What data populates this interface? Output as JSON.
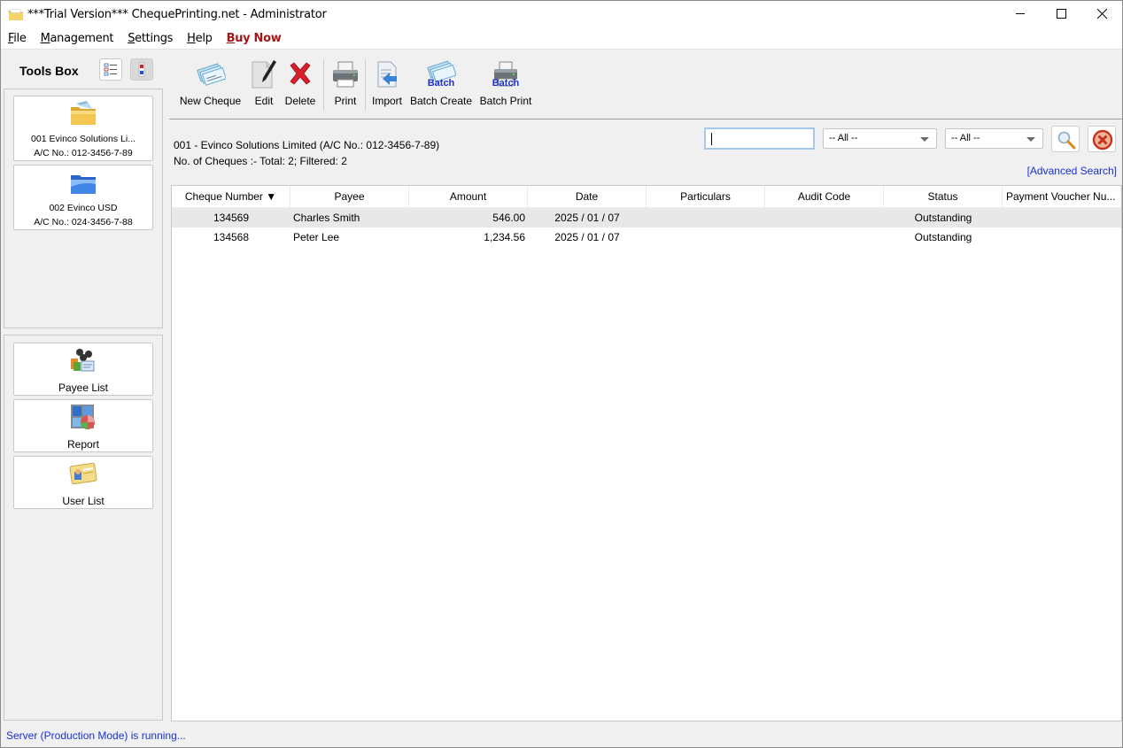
{
  "window": {
    "title": "***Trial Version*** ChequePrinting.net - Administrator",
    "controls": {
      "minimize": "minimize",
      "maximize": "maximize",
      "close": "close"
    }
  },
  "menu": {
    "items": [
      {
        "label_u": "F",
        "label_rest": "ile"
      },
      {
        "label_u": "M",
        "label_rest": "anagement"
      },
      {
        "label_u": "S",
        "label_rest": "ettings"
      },
      {
        "label_u": "H",
        "label_rest": "elp"
      },
      {
        "label_u": "B",
        "label_rest": "uy Now"
      }
    ]
  },
  "sidebar": {
    "title": "Tools Box",
    "view_toggle": {
      "list": "list-view",
      "tile": "tile-view",
      "active": "tile"
    },
    "accounts": [
      {
        "name": "001 Evinco Solutions Li...",
        "acno": "A/C No.: 012-3456-7-89",
        "icon": "folder-yellow-cheques-icon"
      },
      {
        "name": "002 Evinco USD",
        "acno": "A/C No.: 024-3456-7-88",
        "icon": "folder-blue-icon"
      }
    ],
    "tools": [
      {
        "label": "Payee List",
        "icon": "payee-list-icon"
      },
      {
        "label": "Report",
        "icon": "report-icon"
      },
      {
        "label": "User List",
        "icon": "user-list-icon"
      }
    ]
  },
  "toolbar": {
    "new_cheque": "New Cheque",
    "edit": "Edit",
    "delete": "Delete",
    "print": "Print",
    "import": "Import",
    "batch_create": "Batch Create",
    "batch_print": "Batch Print",
    "batch_badge": "Batch"
  },
  "main": {
    "account_info": "001 - Evinco Solutions Limited (A/C No.: 012-3456-7-89)",
    "count_info": "No. of Cheques :- Total: 2; Filtered: 2",
    "search": {
      "value": "",
      "placeholder": ""
    },
    "filter1": "-- All --",
    "filter2": "-- All --",
    "advanced_search": "[Advanced Search]"
  },
  "table": {
    "columns": [
      "Cheque Number ▼",
      "Payee",
      "Amount",
      "Date",
      "Particulars",
      "Audit Code",
      "Status",
      "Payment Voucher Nu..."
    ],
    "sort": {
      "column": "Cheque Number",
      "direction": "descending"
    },
    "rows": [
      [
        "134569",
        "Charles Smith",
        "546.00",
        "2025 / 01 / 07",
        "",
        "",
        "Outstanding",
        ""
      ],
      [
        "134568",
        "Peter Lee",
        "1,234.56",
        "2025 / 01 / 07",
        "",
        "",
        "Outstanding",
        ""
      ]
    ],
    "selected_row": 0
  },
  "statusbar": {
    "text": "Server (Production Mode) is running..."
  },
  "colors": {
    "buy_now": "#a4161a",
    "link": "#1a2fd6",
    "selected_row": "#e8e8e8"
  }
}
